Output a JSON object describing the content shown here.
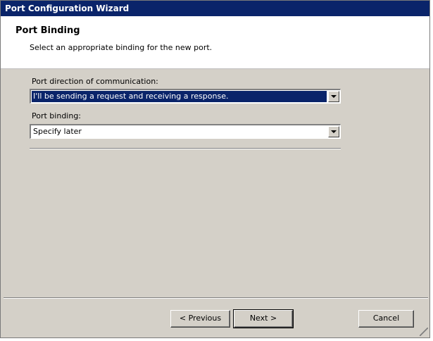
{
  "window": {
    "title": "Port Configuration Wizard"
  },
  "header": {
    "title": "Port Binding",
    "subtitle": "Select an appropriate binding for the new port."
  },
  "fields": {
    "direction": {
      "label": "Port direction of communication:",
      "value": "I'll be sending a request and receiving a response."
    },
    "binding": {
      "label": "Port binding:",
      "value": "Specify later"
    }
  },
  "buttons": {
    "previous": "< Previous",
    "next": "Next >",
    "cancel": "Cancel"
  },
  "colors": {
    "titlebar": "#0a246a",
    "dialog_bg": "#d4d0c8",
    "selection": "#0a246a"
  },
  "icons": {
    "combo_arrow": "chevron-down-icon",
    "resize_grip": "resize-grip-icon"
  }
}
